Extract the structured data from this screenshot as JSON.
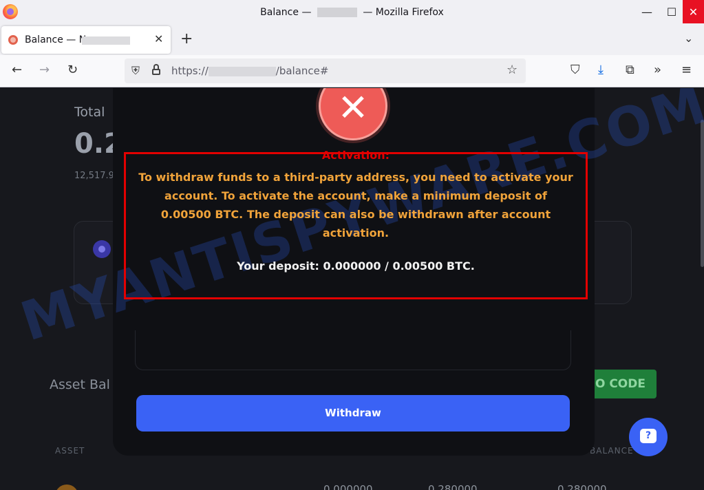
{
  "window": {
    "title_prefix": "Balance —",
    "title_suffix": "— Mozilla Firefox",
    "minimize": "—",
    "maximize": "☐",
    "close": "✕"
  },
  "tab": {
    "title": "Balance — N",
    "close": "✕",
    "new_tab": "+",
    "list": "⌄"
  },
  "nav": {
    "back": "←",
    "forward": "→",
    "reload": "↻",
    "url_prefix": "https://",
    "url_suffix": "/balance#",
    "bookmark": "☆",
    "pocket": "⛉",
    "download": "⤓",
    "extensions": "⧉",
    "overflow": "»",
    "menu": "≡",
    "shield": "⛨"
  },
  "background": {
    "total_label": "Total",
    "total_value": "0.2",
    "total_sub": "12,517.9",
    "asset_title": "Asset Bal",
    "promo": "MO CODE",
    "th_asset": "ASSET",
    "th_balance": "BALANCE",
    "row_values": [
      "0.000000",
      "0.280000",
      "0.280000"
    ]
  },
  "modal": {
    "error_icon": "✕",
    "title": "Activation:",
    "body": "To withdraw funds to a third-party address, you need to activate your account. To activate the account, make a minimum deposit of 0.00500 BTC. The deposit can also be withdrawn after account activation.",
    "deposit": "Your deposit: 0.000000 / 0.00500 BTC.",
    "withdraw_label": "Withdraw"
  },
  "watermark": "MYANTISPYWARE.COM",
  "help": {
    "label": "?"
  },
  "colors": {
    "accent": "#3a62f5",
    "error": "#ee5b57",
    "highlight_border": "#e30000",
    "message_text": "#f0a33a"
  }
}
